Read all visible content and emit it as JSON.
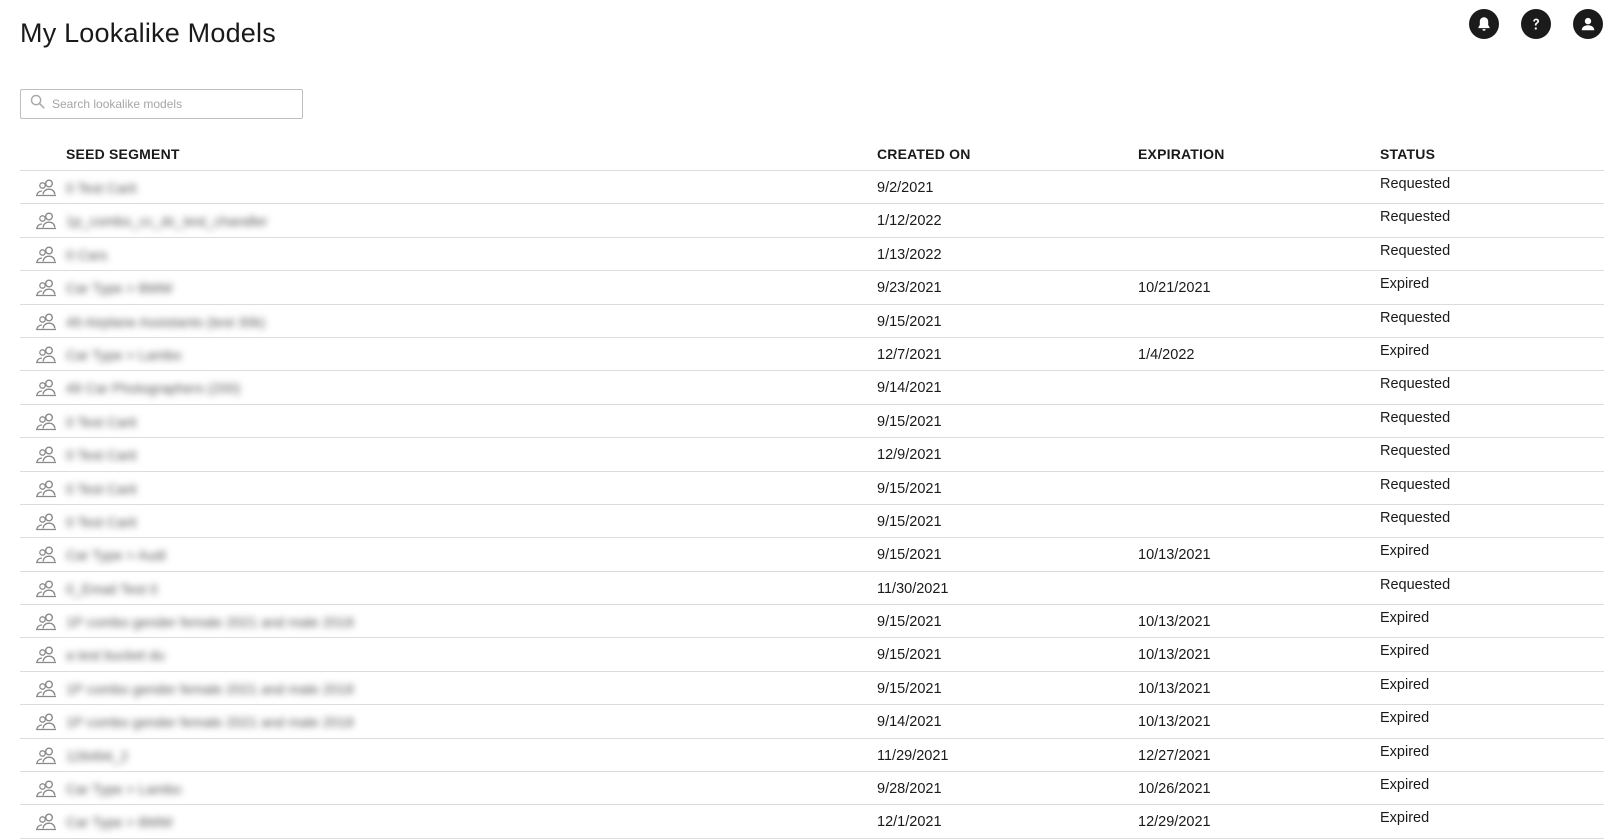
{
  "header": {
    "title": "My Lookalike Models",
    "icons": [
      "bell-icon",
      "help-icon",
      "account-icon"
    ]
  },
  "search": {
    "placeholder": "Search lookalike models",
    "value": ""
  },
  "table": {
    "columns": {
      "seed": "SEED SEGMENT",
      "created": "CREATED ON",
      "expiration": "EXPIRATION",
      "status": "STATUS"
    },
    "rows": [
      {
        "seed": "0 Test Carit",
        "created": "9/2/2021",
        "expiration": "",
        "status": "Requested"
      },
      {
        "seed": "1p_combo_cc_dc_test_chandler",
        "created": "1/12/2022",
        "expiration": "",
        "status": "Requested"
      },
      {
        "seed": "0 Cars",
        "created": "1/13/2022",
        "expiration": "",
        "status": "Requested"
      },
      {
        "seed": "Car Type > BMW",
        "created": "9/23/2021",
        "expiration": "10/21/2021",
        "status": "Expired"
      },
      {
        "seed": "49 Airplane Assistants (test 30k)",
        "created": "9/15/2021",
        "expiration": "",
        "status": "Requested"
      },
      {
        "seed": "Car Type > Lambo",
        "created": "12/7/2021",
        "expiration": "1/4/2022",
        "status": "Expired"
      },
      {
        "seed": "49 Car Photographers (200)",
        "created": "9/14/2021",
        "expiration": "",
        "status": "Requested"
      },
      {
        "seed": "0 Test Carit",
        "created": "9/15/2021",
        "expiration": "",
        "status": "Requested"
      },
      {
        "seed": "0 Test Carit",
        "created": "12/9/2021",
        "expiration": "",
        "status": "Requested"
      },
      {
        "seed": "0 Test Carit",
        "created": "9/15/2021",
        "expiration": "",
        "status": "Requested"
      },
      {
        "seed": "0 Test Carit",
        "created": "9/15/2021",
        "expiration": "",
        "status": "Requested"
      },
      {
        "seed": "Car Type > Audi",
        "created": "9/15/2021",
        "expiration": "10/13/2021",
        "status": "Expired"
      },
      {
        "seed": "0_Email Test 0",
        "created": "11/30/2021",
        "expiration": "",
        "status": "Requested"
      },
      {
        "seed": "1P combo gender female 2021 and male 2018",
        "created": "9/15/2021",
        "expiration": "10/13/2021",
        "status": "Expired"
      },
      {
        "seed": "a test bucket du",
        "created": "9/15/2021",
        "expiration": "10/13/2021",
        "status": "Expired"
      },
      {
        "seed": "1P combo gender female 2021 and male 2018",
        "created": "9/15/2021",
        "expiration": "10/13/2021",
        "status": "Expired"
      },
      {
        "seed": "1P combo gender female 2021 and male 2018",
        "created": "9/14/2021",
        "expiration": "10/13/2021",
        "status": "Expired"
      },
      {
        "seed": "126494_2",
        "created": "11/29/2021",
        "expiration": "12/27/2021",
        "status": "Expired"
      },
      {
        "seed": "Car Type > Lambo",
        "created": "9/28/2021",
        "expiration": "10/26/2021",
        "status": "Expired"
      },
      {
        "seed": "Car Type > BMW",
        "created": "12/1/2021",
        "expiration": "12/29/2021",
        "status": "Expired"
      }
    ]
  },
  "colors": {
    "icon_dark": "#1b1b1b",
    "row_icon": "#8a8a8a",
    "divider": "#dcdcdc"
  }
}
